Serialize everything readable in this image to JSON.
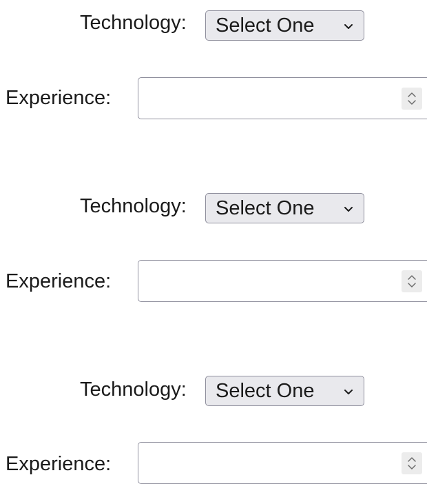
{
  "forms": [
    {
      "technology": {
        "label": "Technology:",
        "selected": "Select One"
      },
      "experience": {
        "label": "Experience:",
        "value": ""
      }
    },
    {
      "technology": {
        "label": "Technology:",
        "selected": "Select One"
      },
      "experience": {
        "label": "Experience:",
        "value": ""
      }
    },
    {
      "technology": {
        "label": "Technology:",
        "selected": "Select One"
      },
      "experience": {
        "label": "Experience:",
        "value": ""
      }
    }
  ],
  "icons": {
    "dropdown": "chevron-down-icon",
    "spinner": "spinner-arrows-icon"
  },
  "colors": {
    "text": "#1b1b1b",
    "select_bg": "#e9e9ed",
    "border": "#8f8f9d"
  }
}
